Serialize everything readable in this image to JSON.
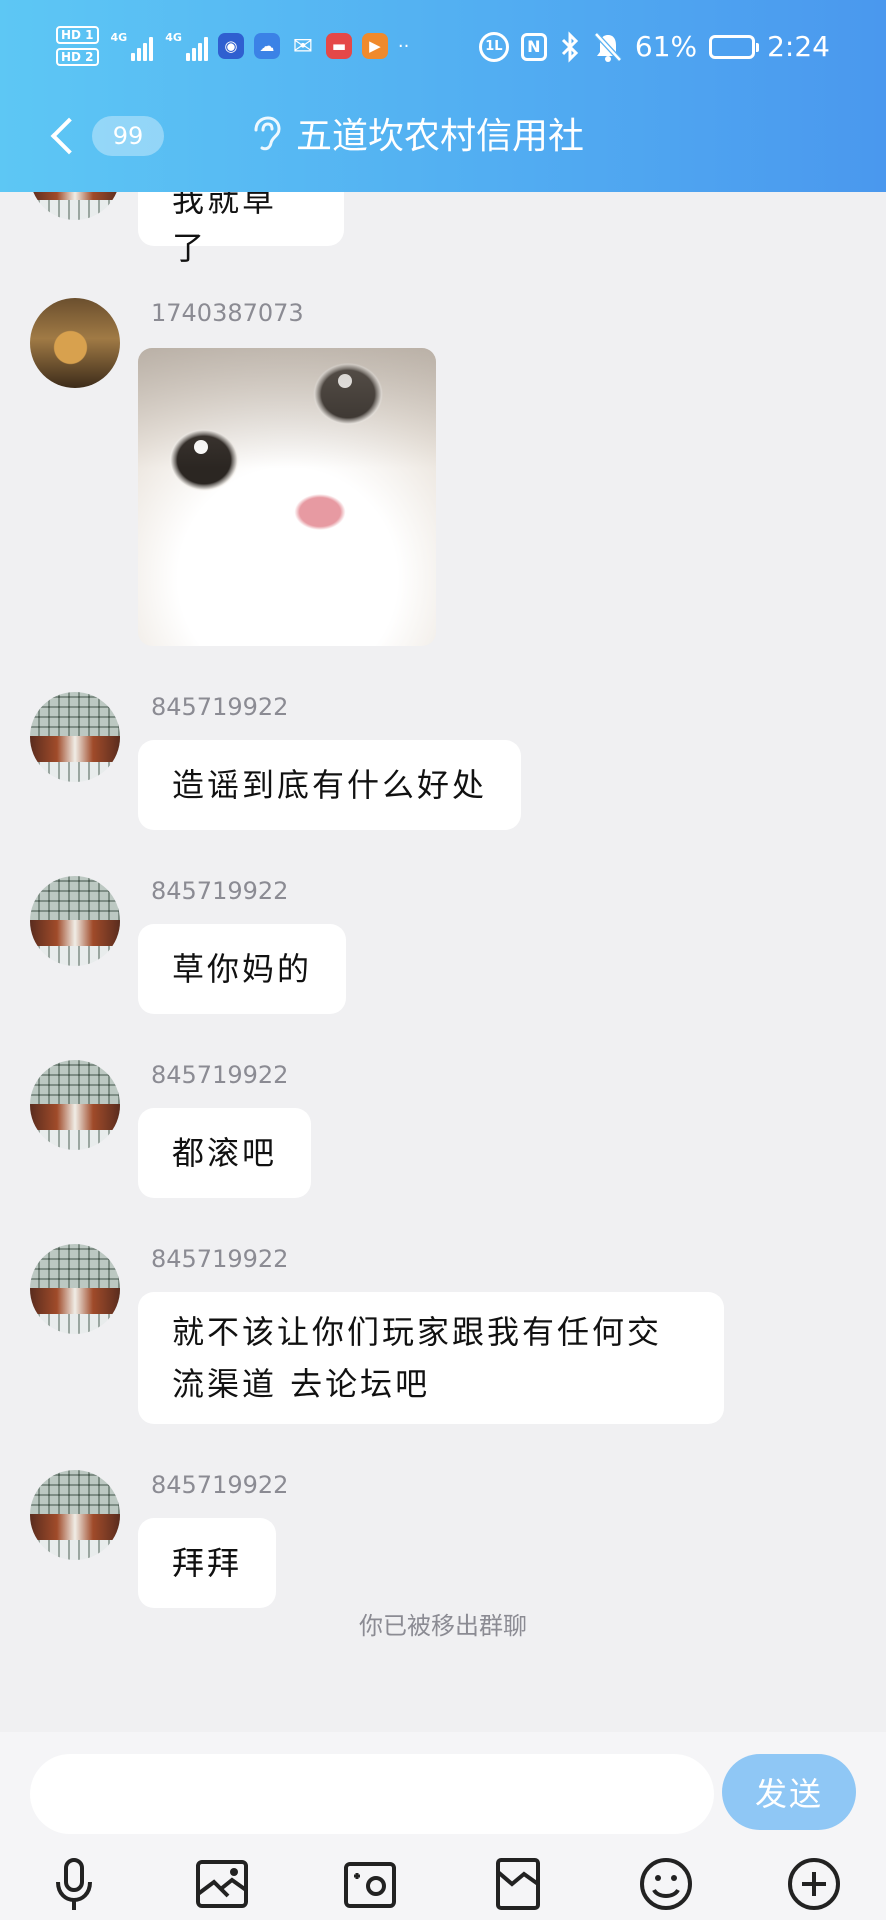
{
  "status_bar": {
    "hd1": "HD 1",
    "hd2": "HD 2",
    "net1": "4G",
    "net2": "4G",
    "battery_percent": "61%",
    "battery_level": 0.61,
    "time": "2:24",
    "app_icons": [
      "browser-icon",
      "cloud-icon",
      "wechat-icon",
      "mail-icon",
      "video-icon"
    ],
    "more": "··"
  },
  "nav": {
    "back": "back-arrow-icon",
    "unread_count": "99",
    "earpiece_icon": "ear-icon",
    "title": "五道坎农村信用社"
  },
  "messages": [
    {
      "type": "text",
      "sender": "",
      "text": "我就草了",
      "partial": true
    },
    {
      "type": "image",
      "sender": "1740387073",
      "image": "cat-photo"
    },
    {
      "type": "text",
      "sender": "845719922",
      "text": "造谣到底有什么好处"
    },
    {
      "type": "text",
      "sender": "845719922",
      "text": "草你妈的"
    },
    {
      "type": "text",
      "sender": "845719922",
      "text": "都滚吧"
    },
    {
      "type": "text",
      "sender": "845719922",
      "lines": [
        "就不该让你们玩家跟我有任何交",
        "流渠道 去论坛吧"
      ]
    },
    {
      "type": "text",
      "sender": "845719922",
      "text": "拜拜"
    }
  ],
  "system_note": "你已被移出群聊",
  "input": {
    "placeholder": "",
    "value": "",
    "send_label": "发送"
  },
  "toolbar": [
    "microphone-icon",
    "photo-album-icon",
    "camera-icon",
    "file-icon",
    "emoji-icon",
    "plus-icon"
  ],
  "colors": {
    "header_start": "#5dc7f4",
    "header_end": "#4a98ee",
    "chat_bg": "#f0f0f2",
    "send_button": "#8fc7f5"
  }
}
